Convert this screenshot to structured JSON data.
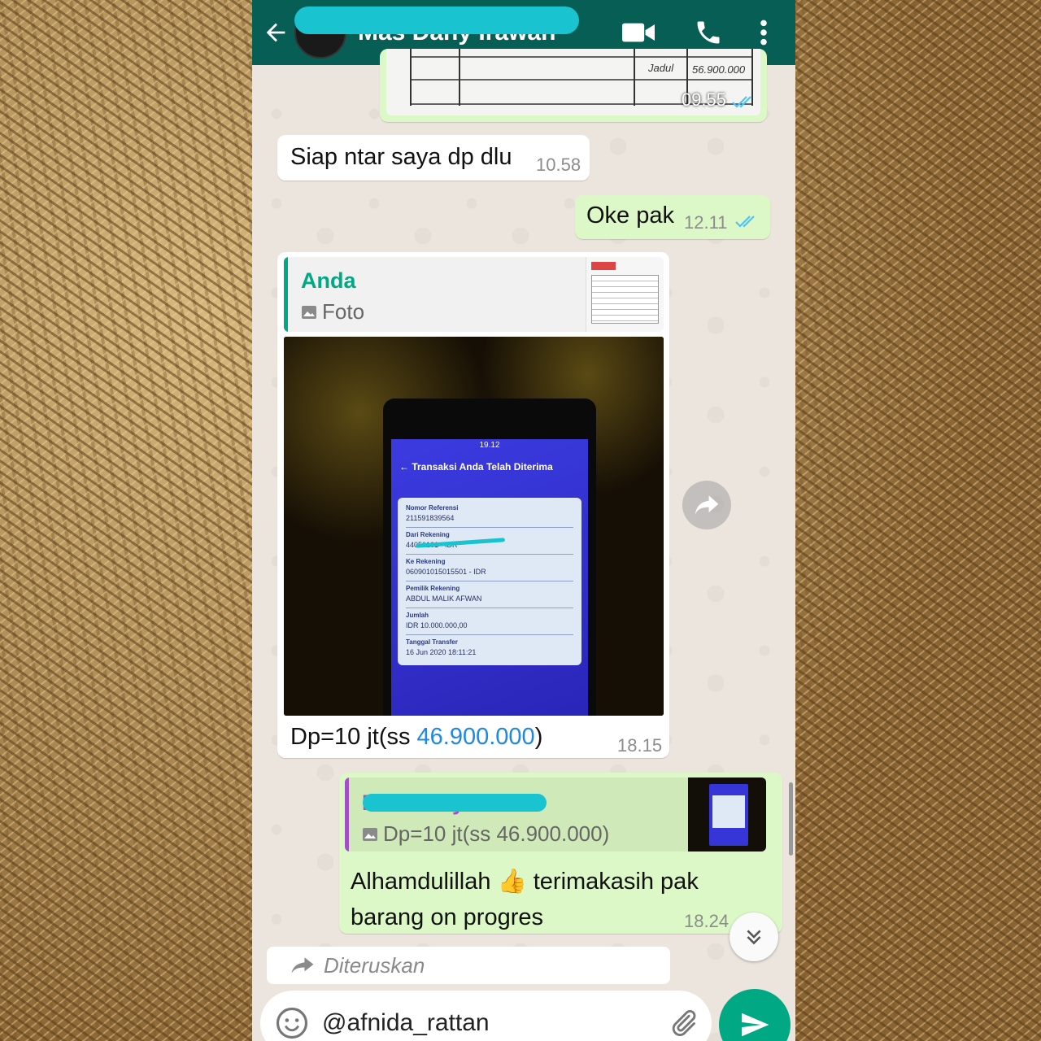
{
  "header": {
    "contact_name": "Mas Dany Irawan",
    "icons": [
      "back-arrow-icon",
      "video-call-icon",
      "phone-icon",
      "more-vert-icon"
    ],
    "color": "#075e54"
  },
  "messages": {
    "top_photo": {
      "time": "09.55",
      "amount_text": "56.900.000",
      "label": "Jadul"
    },
    "m1": {
      "text": "Siap ntar saya dp dlu",
      "time": "10.58"
    },
    "m2": {
      "text": "Oke pak",
      "time": "12.11"
    },
    "m3": {
      "reply_name": "Anda",
      "reply_sub": "Foto",
      "text_prefix": "Dp=10 jt(ss ",
      "text_link": "46.900.000",
      "text_suffix": ")",
      "time": "18.15",
      "screenshot": {
        "time": "19.12",
        "title": "Transaksi Anda Telah Diterima",
        "rows": [
          {
            "label": "Nomor Referensi",
            "value": "211591839564"
          },
          {
            "label": "Dari Rekening",
            "value": "44050101 - IDR"
          },
          {
            "label": "Ke Rekening",
            "value": "060901015015501 - IDR"
          },
          {
            "label": "Pemilik Rekening",
            "value": "ABDUL MALIK AFWAN"
          },
          {
            "label": "Jumlah",
            "value": "IDR 10.000.000,00"
          },
          {
            "label": "Tanggal Transfer",
            "value": "16 Jun 2020 18:11:21"
          }
        ]
      }
    },
    "m4": {
      "reply_name": "Mas Dany Irawan",
      "reply_sub": "Dp=10 jt(ss 46.900.000)",
      "text_line1": "Alhamdulillah",
      "emoji": "👍",
      "text_line1b": " terimakasih pak",
      "text_line2": "barang on progres",
      "time": "18.24"
    }
  },
  "forwarded": {
    "label": "Diteruskan"
  },
  "composer": {
    "text": "@afnida_rattan"
  },
  "colors": {
    "outgoing": "#dcf8c6",
    "incoming": "#ffffff",
    "accent": "#00a884",
    "link": "#1e88e5",
    "redaction": "#19c3cf"
  }
}
